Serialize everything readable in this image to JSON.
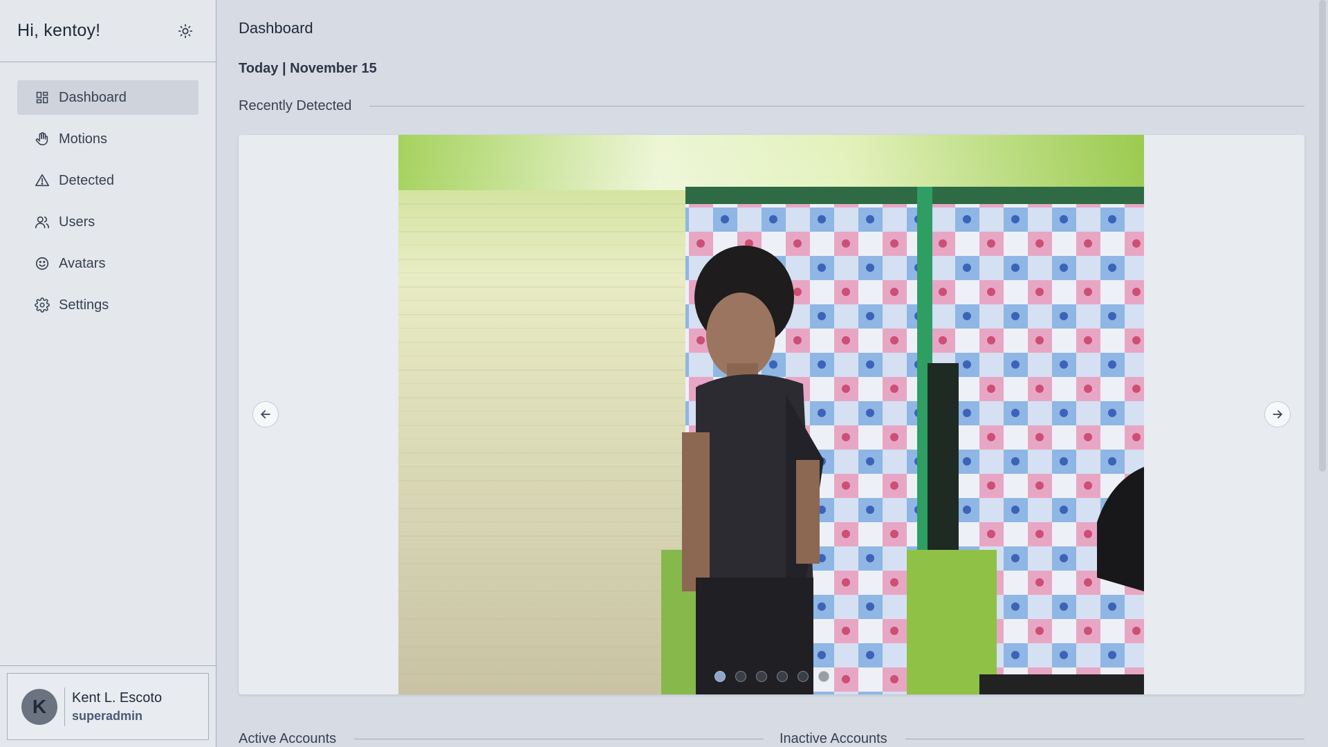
{
  "sidebar": {
    "greeting": "Hi, kentoy!",
    "theme_icon": "sun-icon",
    "items": [
      {
        "label": "Dashboard",
        "icon": "grid-icon",
        "active": true
      },
      {
        "label": "Motions",
        "icon": "hand-icon",
        "active": false
      },
      {
        "label": "Detected",
        "icon": "warning-icon",
        "active": false
      },
      {
        "label": "Users",
        "icon": "users-icon",
        "active": false
      },
      {
        "label": "Avatars",
        "icon": "smiley-icon",
        "active": false
      },
      {
        "label": "Settings",
        "icon": "gear-icon",
        "active": false
      }
    ],
    "profile": {
      "initial": "K",
      "name": "Kent L. Escoto",
      "role": "superadmin"
    }
  },
  "main": {
    "title": "Dashboard",
    "today": "Today | November 15",
    "recently_detected": "Recently Detected",
    "carousel": {
      "slide_count": 6,
      "active_slide": 1,
      "prev_icon": "arrow-left-icon",
      "next_icon": "arrow-right-icon"
    },
    "active_accounts": "Active Accounts",
    "inactive_accounts": "Inactive Accounts"
  }
}
